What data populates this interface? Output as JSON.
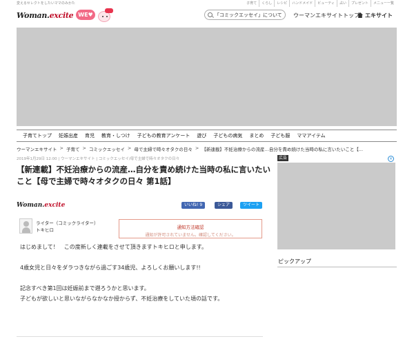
{
  "topbar": {
    "tagline": "変えるセレクトをしたいママのみかた",
    "links": [
      "子育て",
      "くらし",
      "レシピ",
      "ハンドメイド",
      "ビューティ",
      "占い",
      "プレゼント",
      "メニュー一覧"
    ]
  },
  "header": {
    "logo_main": "Woman.",
    "logo_ex": "excite",
    "badge": "WE♥",
    "search_value": "「コミックエッセイ」について",
    "link_woman_top": "ウーマンエキサイトトップ",
    "link_excite": "エキサイト"
  },
  "nav": [
    "子育てトップ",
    "妊娠出産",
    "育児",
    "教育・しつけ",
    "子どもの教育アンケート",
    "遊び",
    "子どもの病気",
    "まとめ",
    "子ども服",
    "ママアイテム"
  ],
  "breadcrumb": [
    "ウーマンエキサイト",
    "子育て",
    "コミックエッセイ",
    "母で主婦で時々オタクの日々",
    "【新連載】不妊治療からの流産…自分を責め続けた当時の私に言いたいこと【..."
  ],
  "article": {
    "dateline": "2019年1月29日 12:00 | ウーマンエキサイト | コミックエッセイ/母で主婦で時々オタクの日々",
    "title": "【新連載】不妊治療からの流産…自分を責め続けた当時の私に言いたいこと【母で主婦で時々オタクの日々 第1話】",
    "byline_logo_main": "Woman.",
    "byline_logo_ex": "excite",
    "share_like": "いいね! 9",
    "share_fb": "シェア",
    "share_tw": "ツイート",
    "author_role": "ライター（コミックライター）",
    "author_name": "トキヒロ",
    "notice_title": "通知方法確認",
    "notice_sub": "通知が許可されていません。確認してください。",
    "paragraphs": [
      "はじめまして！　この度新しく連載をさせて頂きますトキヒロと申します。",
      "4歳女児と日々をダラつきながら過ごす34歳児、よろしくお願いします!!",
      "記念すべき第1回は妊娠前まで遡ろうかと思います。\n子どもが欲しいと思いながらなかなか授からず、不妊治療をしていた頃の話です。"
    ]
  },
  "sidebar": {
    "ad_label": "広告",
    "ad_close": "×",
    "pickup_heading": "ピックアップ"
  },
  "colors": {
    "accent_red": "#c0102a",
    "placeholder_gray": "#cacaca",
    "facebook": "#3b5998",
    "twitter": "#1da1f2"
  }
}
